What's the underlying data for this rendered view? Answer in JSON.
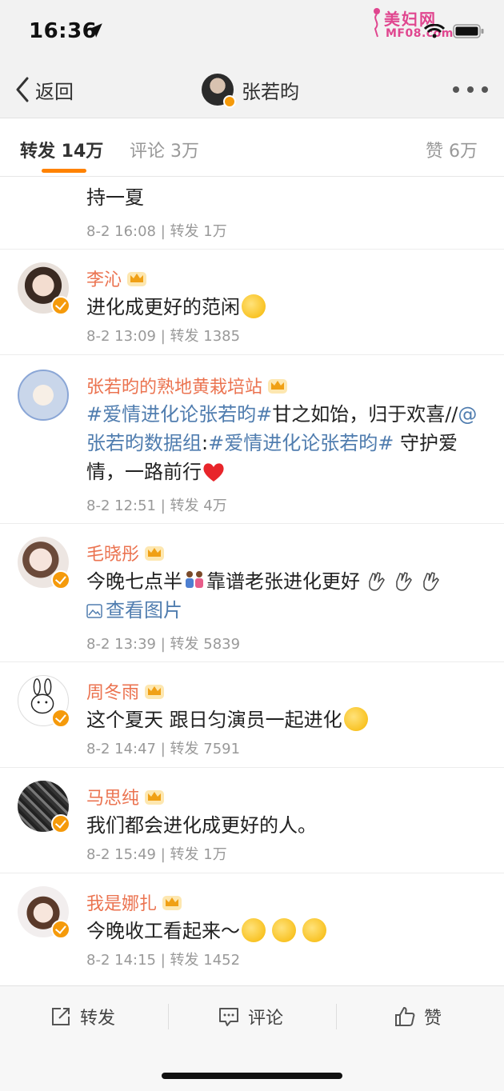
{
  "status_bar": {
    "time": "16:36",
    "watermark_line1": "美妇网",
    "watermark_line2": "MF08.com"
  },
  "nav": {
    "back_label": "返回",
    "title": "张若昀"
  },
  "tabs": {
    "repost": "转发 14万",
    "comment": "评论 3万",
    "like": "赞 6万"
  },
  "feed": [
    {
      "text": "持一夏",
      "time": "8-2 16:08",
      "repost_label": "转发",
      "reposts": "1万"
    },
    {
      "user": "李沁",
      "text": "进化成更好的范闲",
      "time": "8-2 13:09",
      "repost_label": "转发",
      "reposts": "1385"
    },
    {
      "user": "张若昀的熟地黄栽培站",
      "tag1": "#爱情进化论张若昀#",
      "text_part1": "甘之如饴，归于欢喜//",
      "mention": "@张若昀数据组",
      "colon": ":",
      "tag2": "#爱情进化论张若昀#",
      "text_part2": " 守护爱情，一路前行",
      "time": "8-2 12:51",
      "repost_label": "转发",
      "reposts": "4万"
    },
    {
      "user": "毛晓彤",
      "text_part1": "今晚七点半",
      "text_part2": "靠谱老张进化更好",
      "image_link": "查看图片",
      "time": "8-2 13:39",
      "repost_label": "转发",
      "reposts": "5839"
    },
    {
      "user": "周冬雨",
      "text": "这个夏天 跟日匀演员一起进化",
      "time": "8-2 14:47",
      "repost_label": "转发",
      "reposts": "7591"
    },
    {
      "user": "马思纯",
      "text": "我们都会进化成更好的人。",
      "time": "8-2 15:49",
      "repost_label": "转发",
      "reposts": "1万"
    },
    {
      "user": "我是娜扎",
      "text": "今晚收工看起来～",
      "time": "8-2 14:15",
      "repost_label": "转发",
      "reposts": "1452"
    }
  ],
  "toolbar": {
    "repost": "转发",
    "comment": "评论",
    "like": "赞"
  },
  "colors": {
    "accent_orange": "#ff8200",
    "username": "#eb7350",
    "link_blue": "#507daf",
    "verified_badge": "#f59a0b"
  },
  "icons": [
    "location-arrow-icon",
    "wifi-icon",
    "battery-icon",
    "chevron-left-icon",
    "more-icon",
    "crown-icon",
    "verified-badge-icon",
    "drooling-emoji-icon",
    "smile-emoji-icon",
    "heart-icon",
    "family-icon",
    "hand-sign-icon",
    "image-icon",
    "share-icon",
    "comment-icon",
    "thumb-up-icon"
  ]
}
